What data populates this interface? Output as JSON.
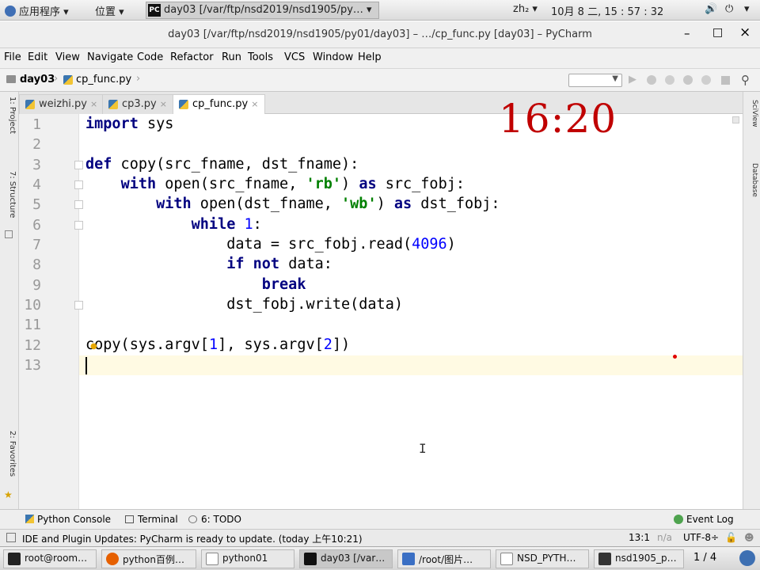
{
  "gnome": {
    "applications": "应用程序",
    "places": "位置",
    "window_title": "day03 [/var/ftp/nsd2019/nsd1905/py…",
    "input_method": "zh₂",
    "datetime": "10月  8 二, 15 : 57 : 32"
  },
  "window": {
    "title": "day03 [/var/ftp/nsd2019/nsd1905/py01/day03] – …/cp_func.py [day03] – PyCharm",
    "minimize": "–",
    "maximize": "□",
    "close": "×"
  },
  "menu": [
    "File",
    "Edit",
    "View",
    "Navigate",
    "Code",
    "Refactor",
    "Run",
    "Tools",
    "VCS",
    "Window",
    "Help"
  ],
  "breadcrumb": {
    "project": "day03",
    "file": "cp_func.py"
  },
  "left_tool_labels": {
    "project": "1: Project",
    "structure": "7: Structure",
    "favorites": "2: Favorites"
  },
  "right_tool_labels": {
    "scview": "SciView",
    "database": "Database"
  },
  "tabs": [
    {
      "label": "weizhi.py"
    },
    {
      "label": "cp3.py"
    },
    {
      "label": "cp_func.py"
    }
  ],
  "overlay_time": "16:20",
  "code_lines": [
    {
      "n": "1",
      "t": "import sys"
    },
    {
      "n": "2",
      "t": ""
    },
    {
      "n": "3",
      "t": "def copy(src_fname, dst_fname):"
    },
    {
      "n": "4",
      "t": "    with open(src_fname, 'rb') as src_fobj:"
    },
    {
      "n": "5",
      "t": "        with open(dst_fname, 'wb') as dst_fobj:"
    },
    {
      "n": "6",
      "t": "            while 1:"
    },
    {
      "n": "7",
      "t": "                data = src_fobj.read(4096)"
    },
    {
      "n": "8",
      "t": "                if not data:"
    },
    {
      "n": "9",
      "t": "                    break"
    },
    {
      "n": "10",
      "t": "                dst_fobj.write(data)"
    },
    {
      "n": "11",
      "t": ""
    },
    {
      "n": "12",
      "t": "copy(sys.argv[1], sys.argv[2])"
    },
    {
      "n": "13",
      "t": ""
    }
  ],
  "toolwindows": {
    "python_console": "Python Console",
    "terminal": "Terminal",
    "todo": "6: TODO",
    "event_log": "Event Log"
  },
  "status": {
    "message": "IDE and Plugin Updates: PyCharm is ready to update. (today 上午10:21)",
    "position": "13:1",
    "na": "n/a",
    "encoding": "UTF-8÷"
  },
  "taskbar": {
    "items": [
      {
        "label": "root@room…"
      },
      {
        "label": "python百例…"
      },
      {
        "label": "python01"
      },
      {
        "label": "day03 [/var…"
      },
      {
        "label": "/root/图片…"
      },
      {
        "label": "NSD_PYTH…"
      },
      {
        "label": "nsd1905_p…"
      }
    ],
    "workspace": "1 / 4"
  },
  "colors": {
    "keyword": "#000080",
    "string": "#008000",
    "number": "#0000ff",
    "overlay": "#c00000"
  }
}
